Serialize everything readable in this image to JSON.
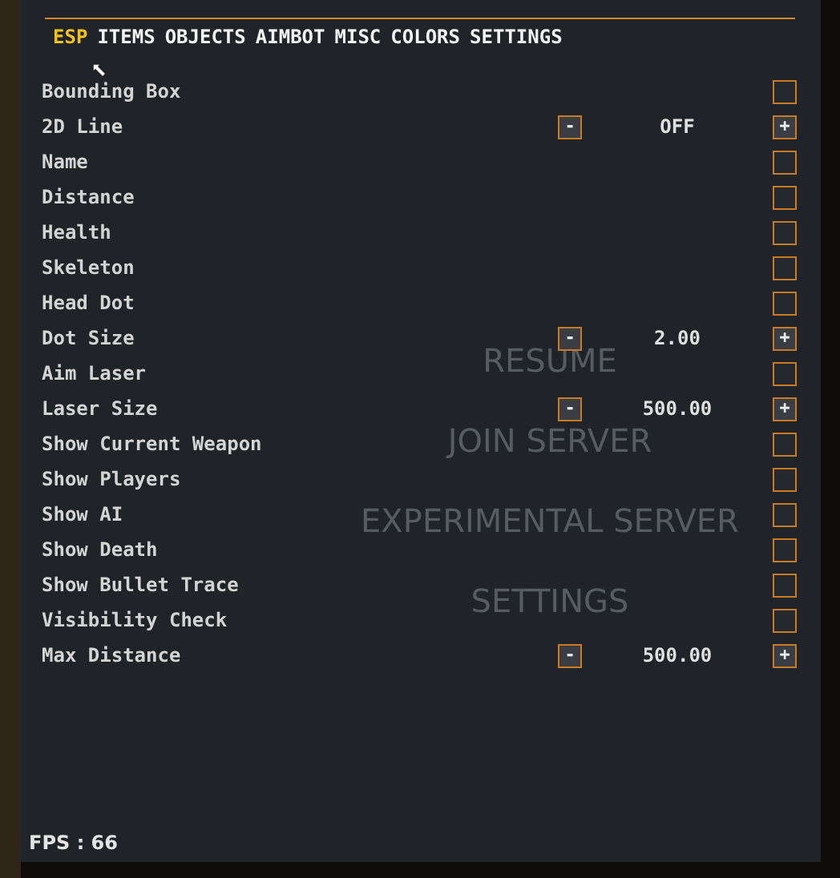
{
  "tabs": [
    {
      "label": "ESP",
      "selected": true
    },
    {
      "label": "ITEMS",
      "selected": false
    },
    {
      "label": "OBJECTS",
      "selected": false
    },
    {
      "label": "AIMBOT",
      "selected": false
    },
    {
      "label": "MISC",
      "selected": false
    },
    {
      "label": "COLORS",
      "selected": false
    },
    {
      "label": "SETTINGS",
      "selected": false
    }
  ],
  "background_menu": [
    "RESUME",
    "JOIN SERVER",
    "EXPERIMENTAL SERVER",
    "SETTINGS"
  ],
  "options": [
    {
      "kind": "checkbox",
      "label": "Bounding Box",
      "checked": false
    },
    {
      "kind": "stepper",
      "label": "2D Line",
      "minus": "-",
      "value": "OFF",
      "plus": "+"
    },
    {
      "kind": "checkbox",
      "label": "Name",
      "checked": false
    },
    {
      "kind": "checkbox",
      "label": "Distance",
      "checked": false
    },
    {
      "kind": "checkbox",
      "label": "Health",
      "checked": false
    },
    {
      "kind": "checkbox",
      "label": "Skeleton",
      "checked": false
    },
    {
      "kind": "checkbox",
      "label": "Head Dot",
      "checked": false
    },
    {
      "kind": "stepper",
      "label": "Dot Size",
      "minus": "-",
      "value": "2.00",
      "plus": "+"
    },
    {
      "kind": "checkbox",
      "label": "Aim Laser",
      "checked": false
    },
    {
      "kind": "stepper",
      "label": "Laser Size",
      "minus": "-",
      "value": "500.00",
      "plus": "+"
    },
    {
      "kind": "checkbox",
      "label": "Show Current Weapon",
      "checked": false
    },
    {
      "kind": "checkbox",
      "label": "Show Players",
      "checked": false
    },
    {
      "kind": "checkbox",
      "label": "Show AI",
      "checked": false
    },
    {
      "kind": "checkbox",
      "label": "Show Death",
      "checked": false
    },
    {
      "kind": "checkbox",
      "label": "Show Bullet Trace",
      "checked": false
    },
    {
      "kind": "checkbox",
      "label": "Visibility Check",
      "checked": false
    },
    {
      "kind": "stepper",
      "label": "Max Distance",
      "minus": "-",
      "value": "500.00",
      "plus": "+"
    }
  ],
  "fps": "FPS : 66"
}
